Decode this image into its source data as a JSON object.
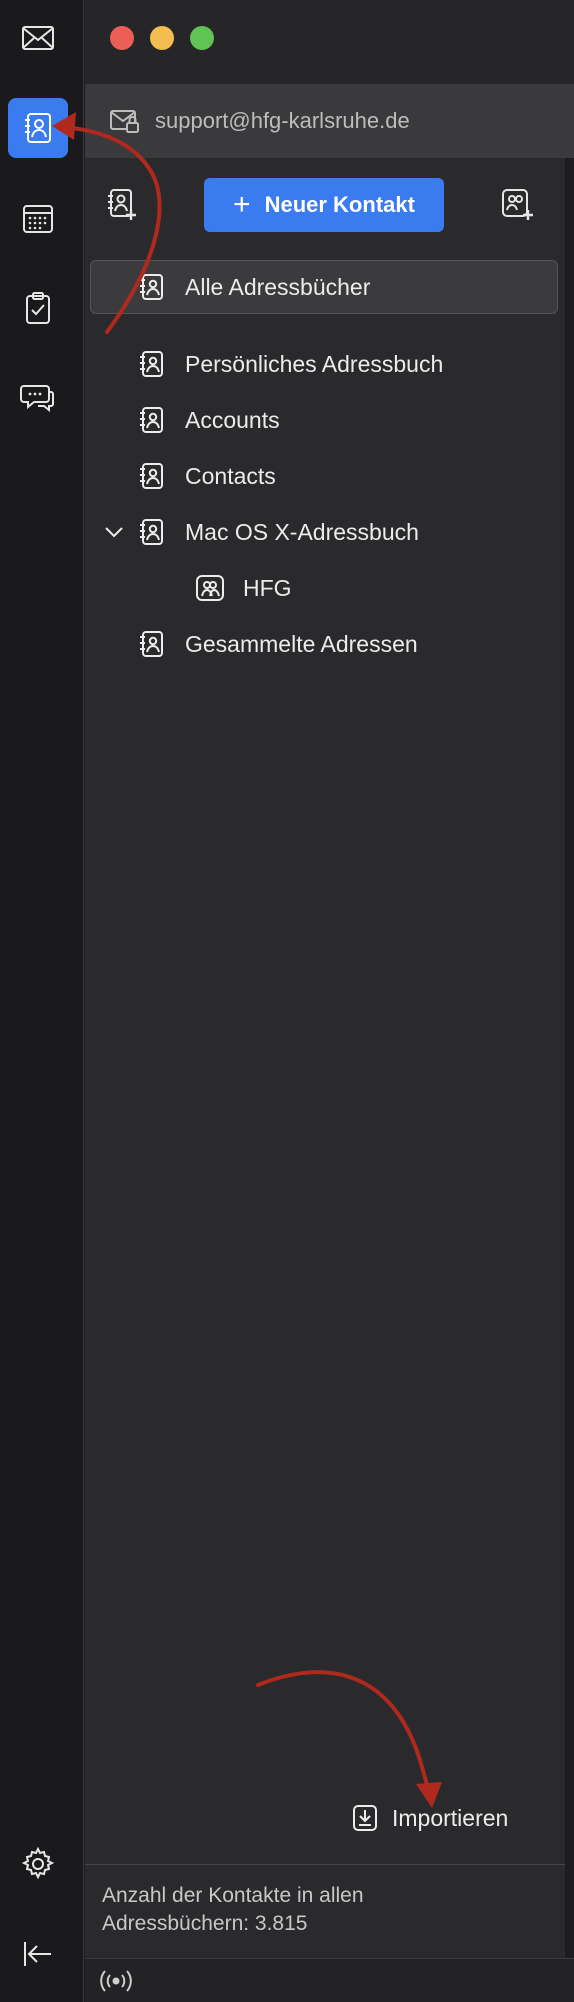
{
  "account": {
    "email": "support@hfg-karlsruhe.de"
  },
  "toolbar": {
    "new_contact_label": "Neuer Kontakt"
  },
  "rail": {
    "items": [
      {
        "name": "mail",
        "active": false
      },
      {
        "name": "address-book",
        "active": true
      },
      {
        "name": "calendar",
        "active": false
      },
      {
        "name": "tasks",
        "active": false
      },
      {
        "name": "chat",
        "active": false
      }
    ]
  },
  "tree": {
    "all_label": "Alle Adressbücher",
    "items": [
      {
        "label": "Persönliches Adressbuch"
      },
      {
        "label": "Accounts"
      },
      {
        "label": "Contacts"
      },
      {
        "label": "Mac OS X-Adressbuch",
        "expanded": true
      },
      {
        "label": "HFG",
        "level": 2
      },
      {
        "label": "Gesammelte Adressen"
      }
    ]
  },
  "import_label": "Importieren",
  "footer": {
    "count_line1": "Anzahl der Kontakte in allen",
    "count_line2": "Adressbüchern: 3.815"
  },
  "colors": {
    "accent": "#3a7bf0",
    "annotation_arrow": "#b0291e"
  }
}
